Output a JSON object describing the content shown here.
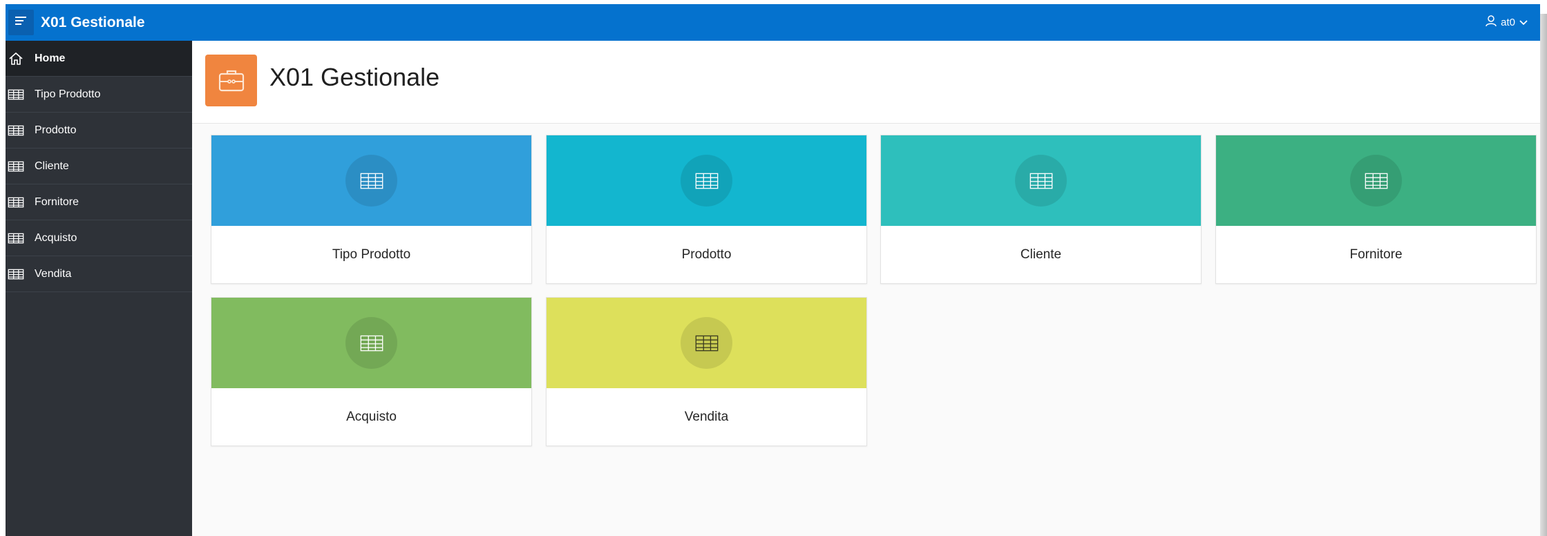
{
  "header": {
    "app_title": "X01 Gestionale",
    "user_name": "at0",
    "color": "#0572ce"
  },
  "sidebar": {
    "items": [
      {
        "label": "Home",
        "icon": "home-icon",
        "active": true
      },
      {
        "label": "Tipo Prodotto",
        "icon": "table-icon"
      },
      {
        "label": "Prodotto",
        "icon": "table-icon"
      },
      {
        "label": "Cliente",
        "icon": "table-icon"
      },
      {
        "label": "Fornitore",
        "icon": "table-icon"
      },
      {
        "label": "Acquisto",
        "icon": "table-icon"
      },
      {
        "label": "Vendita",
        "icon": "table-icon"
      }
    ]
  },
  "page": {
    "title": "X01 Gestionale",
    "icon": "briefcase-icon",
    "icon_color": "#f0853f"
  },
  "cards": [
    {
      "label": "Tipo Prodotto",
      "color": "#309fdb",
      "icon": "table-icon"
    },
    {
      "label": "Prodotto",
      "color": "#13b6cf",
      "icon": "table-icon"
    },
    {
      "label": "Cliente",
      "color": "#2ebfbc",
      "icon": "table-icon"
    },
    {
      "label": "Fornitore",
      "color": "#3cb082",
      "icon": "table-icon"
    },
    {
      "label": "Acquisto",
      "color": "#81bb5f",
      "icon": "table-icon"
    },
    {
      "label": "Vendita",
      "color": "#dde05b",
      "icon": "table-icon"
    }
  ]
}
